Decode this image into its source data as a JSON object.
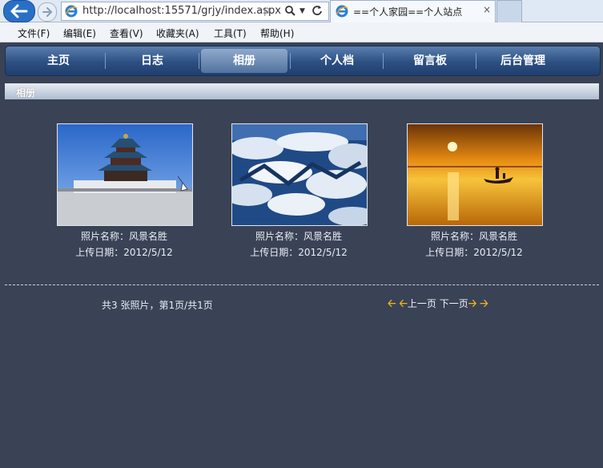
{
  "browser": {
    "address_url": "http://localhost:15571/grjy/index.aspx",
    "address_suffix": "ρ",
    "search_icon": "search-icon",
    "refresh_icon": "refresh-icon",
    "tab_title": "==个人家园==个人站点",
    "tab_close": "×",
    "menu": [
      "文件(F)",
      "编辑(E)",
      "查看(V)",
      "收藏夹(A)",
      "工具(T)",
      "帮助(H)"
    ]
  },
  "nav": {
    "items": [
      "主页",
      "日志",
      "相册",
      "个人档",
      "留言板",
      "后台管理"
    ],
    "active_index": 2
  },
  "breadcrumb": "相册",
  "photos": [
    {
      "name": "照片名称：风景名胜",
      "date": "上传日期：2012/5/12",
      "image": "temple-of-heaven"
    },
    {
      "name": "照片名称：风景名胜",
      "date": "上传日期：2012/5/12",
      "image": "clouds-over-mountains"
    },
    {
      "name": "照片名称：风景名胜",
      "date": "上传日期：2012/5/12",
      "image": "sunset-boat"
    }
  ],
  "pager": {
    "summary": "共3 张照片，第1页/共1页",
    "prev_label": "上一页",
    "next_label": "下一页",
    "first_icon": "arrow-first-icon",
    "last_icon": "arrow-last-icon"
  },
  "colors": {
    "page_bg": "#3a4356",
    "nav_bg": "#2c4f82",
    "accent_arrow": "#f3b31c"
  }
}
